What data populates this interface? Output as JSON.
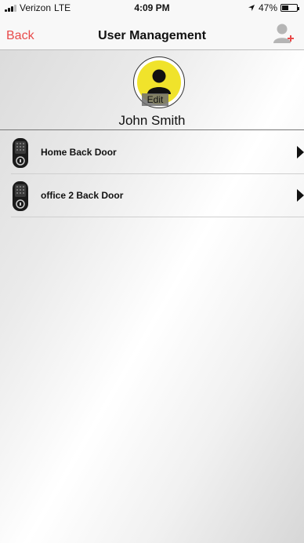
{
  "status_bar": {
    "carrier": "Verizon",
    "network": "LTE",
    "time": "4:09 PM",
    "battery": "47%",
    "battery_level": 0.47
  },
  "nav": {
    "back_label": "Back",
    "title": "User Management",
    "add_icon": "add-user-icon",
    "accent_color": "#e84a4a"
  },
  "profile": {
    "edit_label": "Edit",
    "name": "John Smith",
    "avatar_color": "#f0e32b"
  },
  "doors": [
    {
      "label": "Home Back Door",
      "icon": "door-lock-icon"
    },
    {
      "label": "office 2 Back Door",
      "icon": "door-lock-icon"
    }
  ]
}
